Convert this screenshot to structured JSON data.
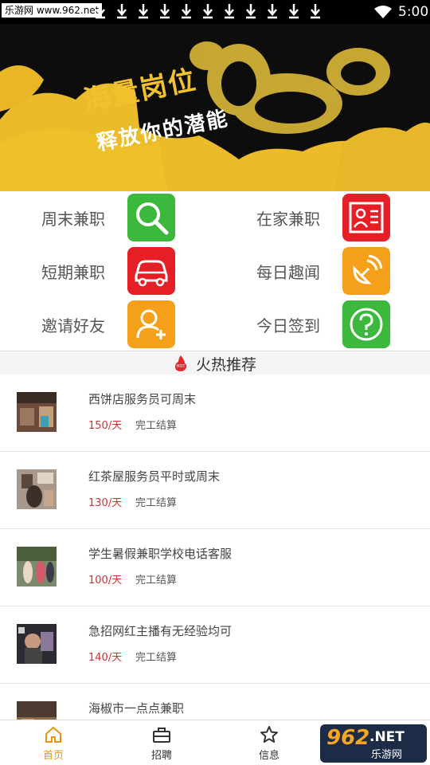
{
  "status_bar": {
    "site_label": "乐游网 www.962.net",
    "time": "5:00",
    "download_icon_count": 11
  },
  "banner": {
    "line1": "海量岗位",
    "line2": "释放你的潜能"
  },
  "categories": [
    {
      "label": "周末兼职",
      "icon": "search-icon",
      "color": "#3cb83c"
    },
    {
      "label": "在家兼职",
      "icon": "id-card-icon",
      "color": "#e61f26"
    },
    {
      "label": "短期兼职",
      "icon": "car-icon",
      "color": "#e61f26"
    },
    {
      "label": "每日趣闻",
      "icon": "satellite-icon",
      "color": "#f5a01a"
    },
    {
      "label": "邀请好友",
      "icon": "add-user-icon",
      "color": "#f5a01a"
    },
    {
      "label": "今日签到",
      "icon": "question-icon",
      "color": "#3cb83c"
    }
  ],
  "hot_section": {
    "title": "火热推荐",
    "badge": "HOT"
  },
  "jobs": [
    {
      "title": "西饼店服务员可周末",
      "pay": "150/天",
      "settle": "完工结算"
    },
    {
      "title": "红茶屋服务员平时或周末",
      "pay": "130/天",
      "settle": "完工结算"
    },
    {
      "title": "学生暑假兼职学校电话客服",
      "pay": "100/天",
      "settle": "完工结算"
    },
    {
      "title": "急招网红主播有无经验均可",
      "pay": "140/天",
      "settle": "完工结算"
    },
    {
      "title": "海椒市一点点兼职",
      "pay": "",
      "settle": ""
    }
  ],
  "bottom_nav": [
    {
      "label": "首页",
      "icon": "home-icon",
      "active": true
    },
    {
      "label": "招聘",
      "icon": "briefcase-icon",
      "active": false
    },
    {
      "label": "信息",
      "icon": "star-icon",
      "active": false
    }
  ],
  "watermark": {
    "brand_number": "962",
    "brand_domain": ".NET",
    "brand_name": "乐游网"
  },
  "colors": {
    "accent_yellow": "#f2c22e",
    "active_tab": "#e8960f",
    "price_red": "#d23030"
  }
}
